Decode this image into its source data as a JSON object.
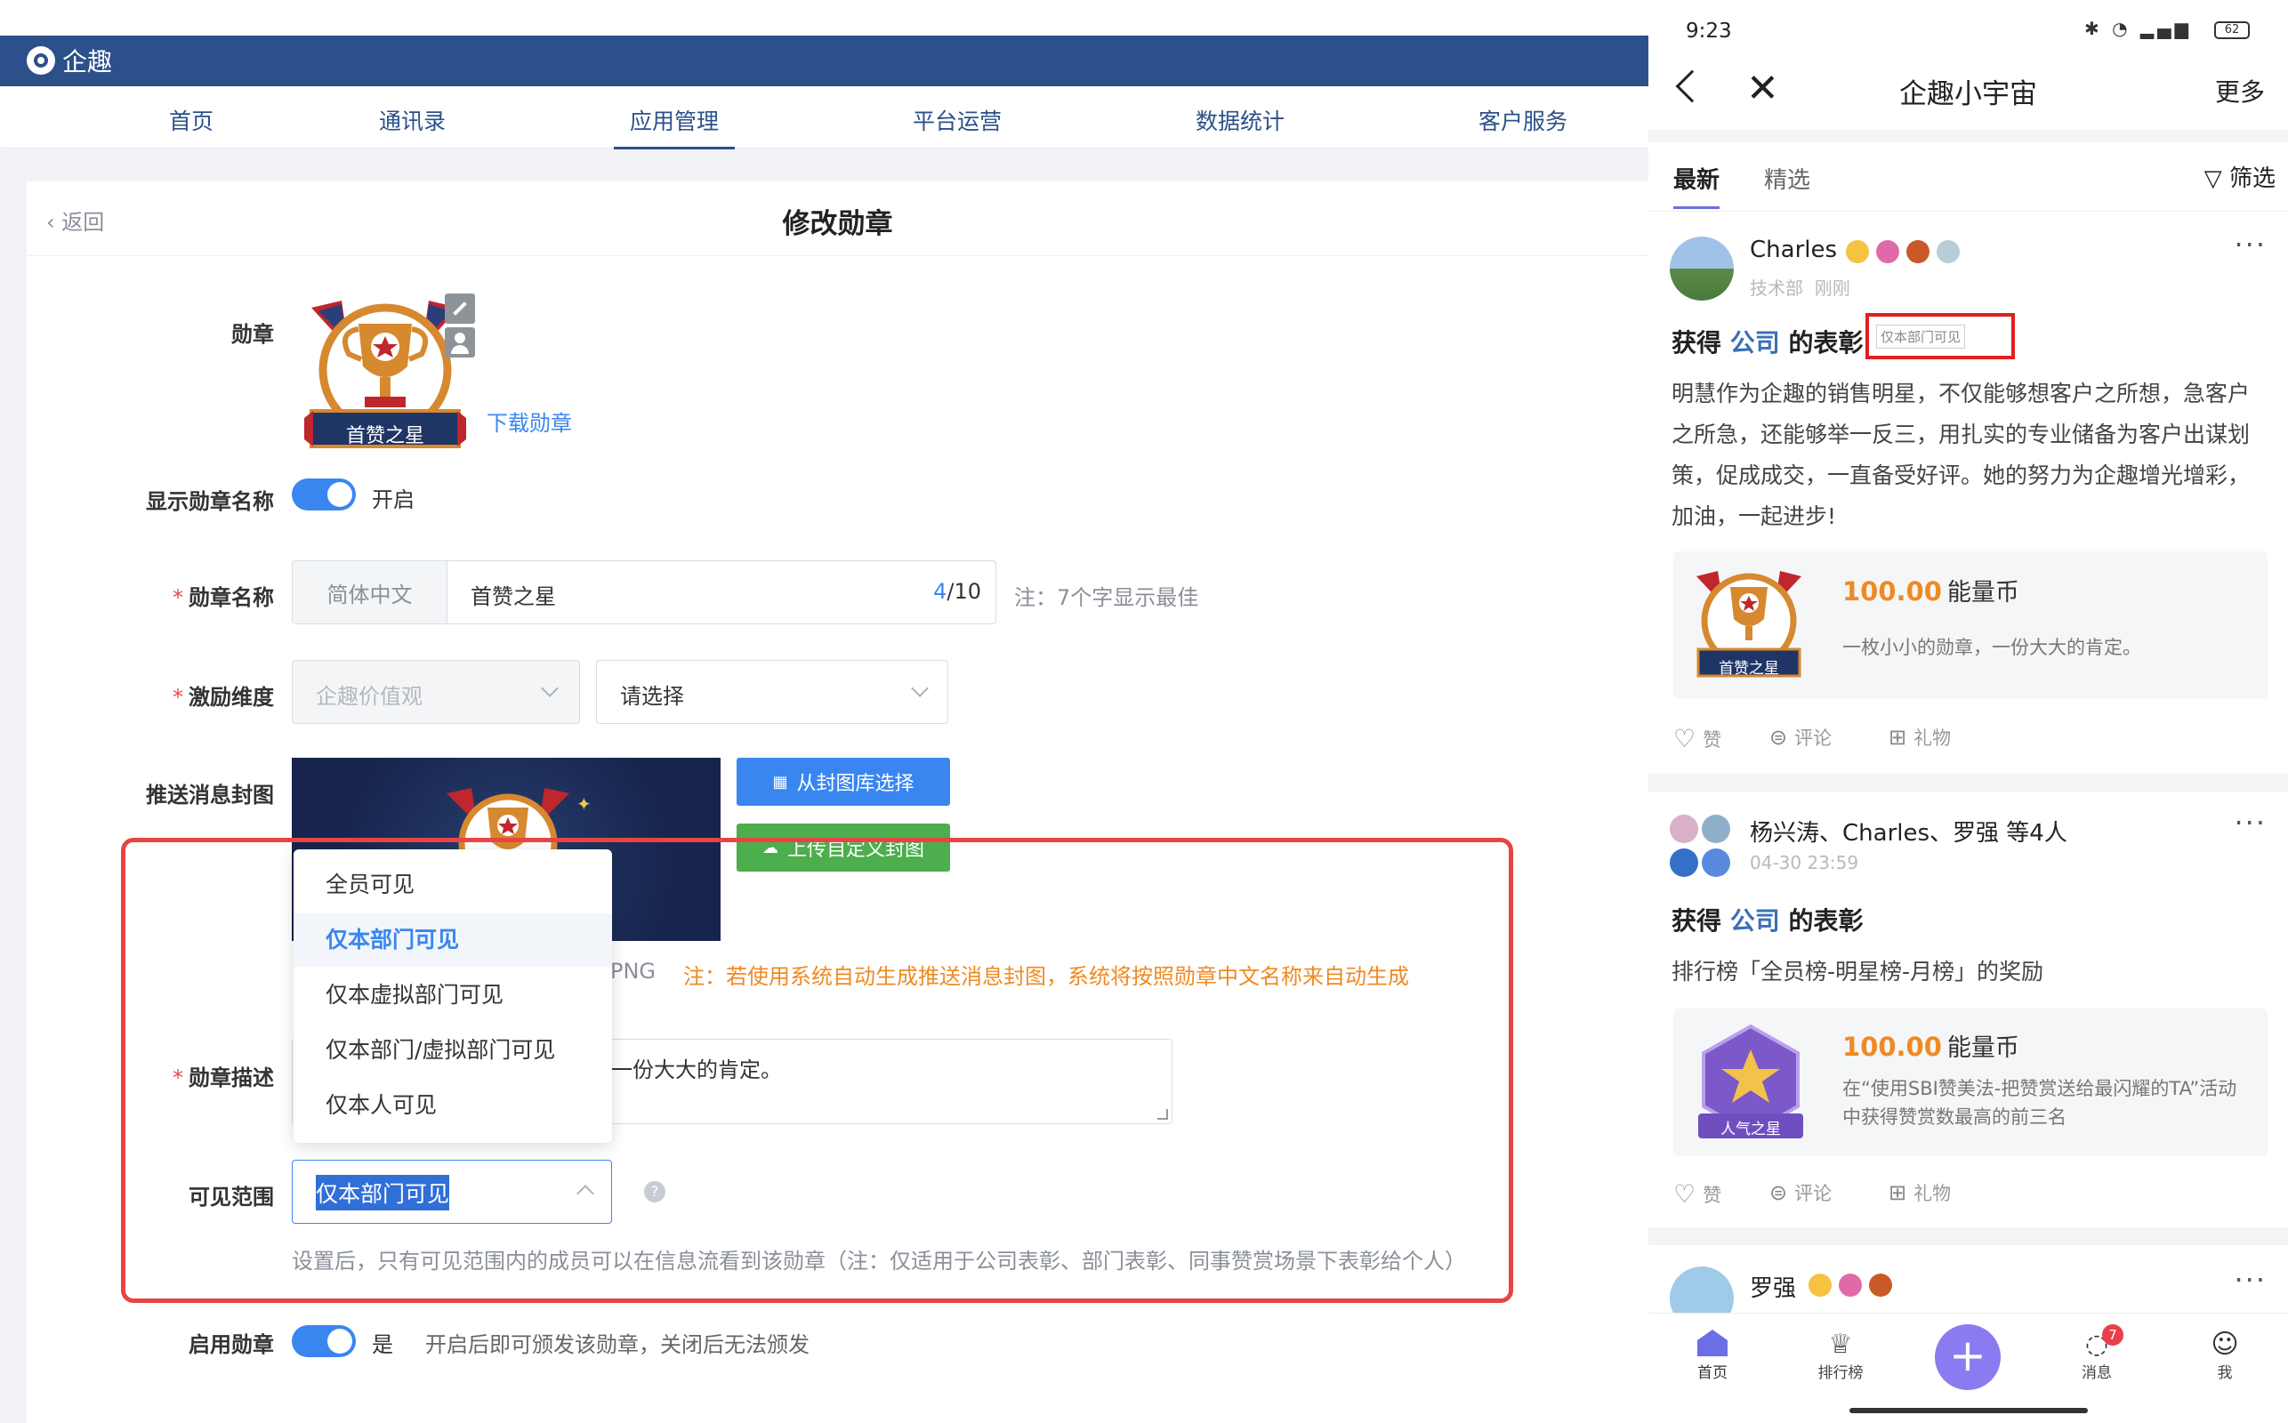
{
  "admin": {
    "brand": "企趣",
    "nav": [
      "首页",
      "通讯录",
      "应用管理",
      "平台运营",
      "数据统计",
      "客户服务"
    ],
    "nav_active": "应用管理",
    "back_label": "返回",
    "title": "修改勋章",
    "badge_label": "勋章",
    "badge_image_text": "首赞之星",
    "download_badge": "下载勋章",
    "show_name_label": "显示勋章名称",
    "show_name_value": "开启",
    "name_label": "勋章名称",
    "name_lang": "简体中文",
    "name_value": "首赞之星",
    "name_count_current": "4",
    "name_count_max": "/10",
    "name_note": "注：7个字显示最佳",
    "dimension_label": "激励维度",
    "dimension_value1": "企趣价值观",
    "dimension_placeholder2": "请选择",
    "cover_label": "推送消息封图",
    "cover_btn_library": "从封图库选择",
    "cover_btn_upload": "上传自定义封图",
    "cover_format": "PNG",
    "cover_note": "注：若使用系统自动生成推送消息封图，系统将按照勋章中文名称来自动生成",
    "desc_label": "勋章描述",
    "desc_value": "一份大大的肯定。",
    "visibility_label": "可见范围",
    "visibility_value": "仅本部门可见",
    "visibility_options": [
      "全员可见",
      "仅本部门可见",
      "仅本虚拟部门可见",
      "仅本部门/虚拟部门可见",
      "仅本人可见"
    ],
    "visibility_selected_index": 1,
    "visibility_note": "设置后，只有可见范围内的成员可以在信息流看到该勋章（注：仅适用于公司表彰、部门表彰、同事赞赏场景下表彰给个人）",
    "enable_label": "启用勋章",
    "enable_value": "是",
    "enable_note": "开启后即可颁发该勋章，关闭后无法颁发",
    "colors": {
      "primary": "#2c5089",
      "accent": "#3a86f0",
      "green": "#4cae4c",
      "warning": "#ef8a22",
      "highlight": "#e84444"
    }
  },
  "phone": {
    "time": "9:23",
    "battery": "62",
    "title": "企趣小宇宙",
    "more": "更多",
    "tab_latest": "最新",
    "tab_featured": "精选",
    "filter": "筛选",
    "post1": {
      "name": "Charles",
      "dept": "技术部",
      "time": "刚刚",
      "title_prefix": "获得",
      "title_company": "公司",
      "title_suffix": "的表彰",
      "visibility_tag": "仅本部门可见",
      "body": "明慧作为企趣的销售明星，不仅能够想客户之所想，急客户之所急，还能够举一反三，用扎实的专业储备为客户出谋划策，促成成交，一直备受好评。她的努力为企趣增光增彩，加油，一起进步!",
      "badge_text": "首赞之星",
      "coin": "100.00",
      "coin_unit": "能量币",
      "reward_desc": "一枚小小的勋章，一份大大的肯定。"
    },
    "post2": {
      "names": "杨兴涛、Charles、罗强 等4人",
      "time": "04-30 23:59",
      "title_prefix": "获得",
      "title_company": "公司",
      "title_suffix": "的表彰",
      "body": "排行榜「全员榜-明星榜-月榜」的奖励",
      "badge_text": "人气之星",
      "coin": "100.00",
      "coin_unit": "能量币",
      "reward_desc": "在“使用SBI赞美法-把赞赏送给最闪耀的TA”活动中获得赞赏数最高的前三名"
    },
    "post3": {
      "name": "罗强"
    },
    "actions": {
      "like": "赞",
      "comment": "评论",
      "gift": "礼物"
    },
    "bottom_nav": [
      "首页",
      "排行榜",
      "消息",
      "我"
    ],
    "message_badge": "7"
  }
}
